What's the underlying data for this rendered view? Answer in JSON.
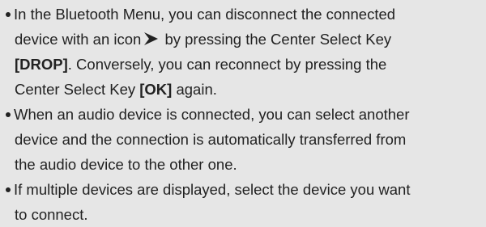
{
  "notes": [
    {
      "lines": {
        "l1": "In the Bluetooth Menu, you can disconnect the connected",
        "l2a": "device with an icon",
        "l2b": " by pressing the Center Select Key",
        "l3a": "[DROP]",
        "l3b": ". Conversely, you can reconnect by pressing the",
        "l4a": "Center Select Key ",
        "l4b": "[OK]",
        "l4c": " again."
      },
      "icon": "connected-device-arrow-icon"
    },
    {
      "lines": {
        "l1": "When an audio device is connected, you can select another",
        "l2": "device and the connection is automatically transferred from",
        "l3": "the audio device to the other one."
      }
    },
    {
      "lines": {
        "l1": "If multiple devices are displayed, select the device you want",
        "l2": "to connect."
      }
    }
  ],
  "colors": {
    "background": "#e6e6e6",
    "text": "#222222"
  }
}
